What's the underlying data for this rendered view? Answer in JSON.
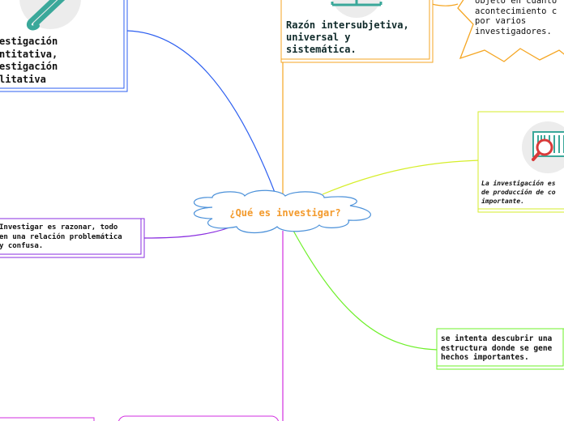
{
  "central": {
    "label": "¿Qué es investigar?",
    "color": "#f39a2c"
  },
  "nodes": {
    "top_left": {
      "text": "estigación\nntitativa,\nestigación\nlitativa"
    },
    "top_middle": {
      "text": "Razón intersubjetiva,\nuniversal y\nsistemática."
    },
    "top_right_callout": {
      "text": "objeto en cuanto\nacontecimiento c\npor varios\ninvestigadores."
    },
    "right_upper": {
      "text": "La investigación es\nde producción de co\nimportante."
    },
    "right_lower": {
      "text": "se intenta descubrir una\nestructura donde se gene\nhechos importantes."
    },
    "left_middle": {
      "text": "Investigar es razonar, todo\nen una relación problemática\ny confusa."
    }
  },
  "colors": {
    "blue": "#2d5ff0",
    "orange": "#f5a623",
    "yellowgreen": "#d6ee2a",
    "green": "#6ef02a",
    "purple": "#8a2ee0",
    "magenta": "#d22ee0",
    "cloud_border": "#4a90d9",
    "cloud_fill": "#ffffff"
  }
}
